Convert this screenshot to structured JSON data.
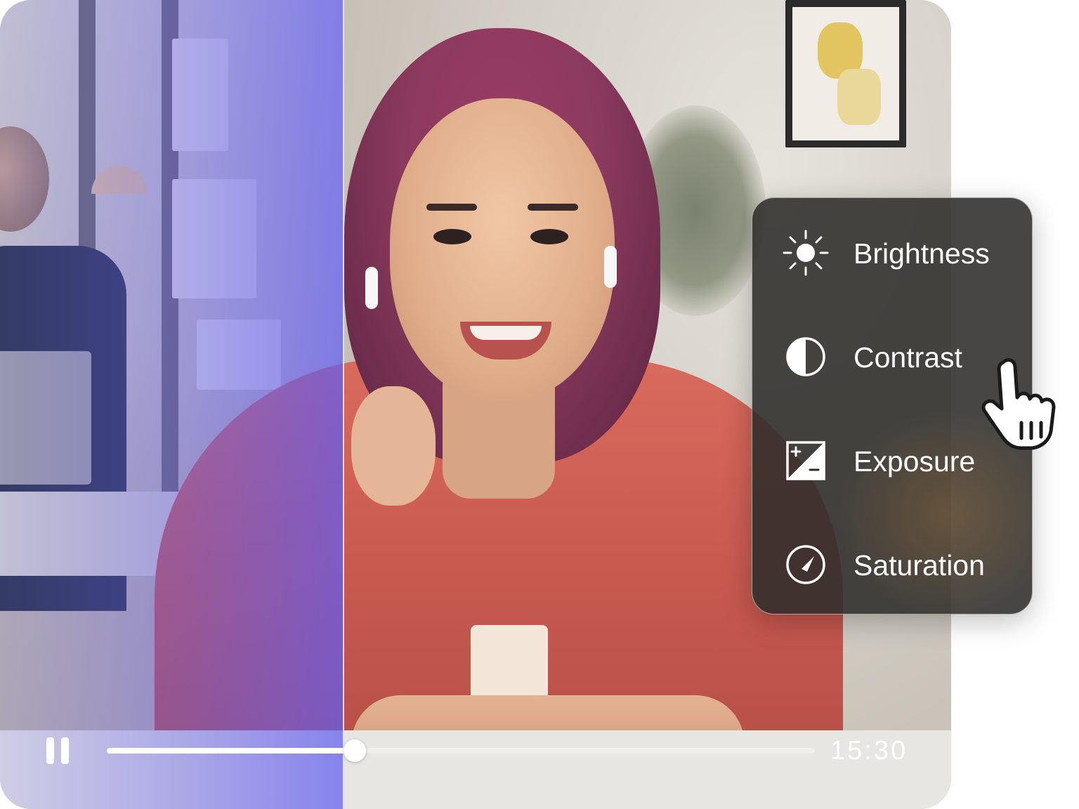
{
  "player": {
    "time": "15:30",
    "progress": 0.35,
    "state": "playing"
  },
  "adjustments_menu": {
    "items": [
      {
        "label": "Brightness",
        "icon": "brightness-icon"
      },
      {
        "label": "Contrast",
        "icon": "contrast-icon"
      },
      {
        "label": "Exposure",
        "icon": "exposure-icon"
      },
      {
        "label": "Saturation",
        "icon": "saturation-icon"
      }
    ],
    "hovered": "Contrast"
  },
  "colors": {
    "overlay": "#5c60ec",
    "menu_background": "#2d2c2a",
    "menu_text": "#ffffff"
  }
}
